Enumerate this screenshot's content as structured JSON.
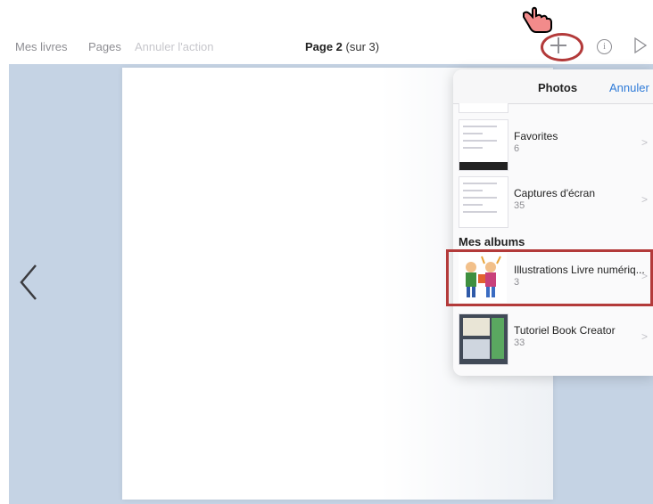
{
  "toolbar": {
    "my_books": "Mes livres",
    "pages": "Pages",
    "undo": "Annuler l'action",
    "page_label": "Page 2",
    "page_total": "(sur 3)"
  },
  "icons": {
    "add": "plus-icon",
    "info": "info-icon",
    "play": "play-icon",
    "back": "chevron-left-icon",
    "cursor": "hand-pointer-icon"
  },
  "colors": {
    "accent": "#2f7bd8",
    "highlight": "#b33a3a",
    "workspace": "#c5d3e4"
  },
  "popover": {
    "title": "Photos",
    "cancel": "Annuler",
    "albums": [
      {
        "label": "Favorites",
        "count": "6"
      },
      {
        "label": "Captures d'écran",
        "count": "35"
      }
    ],
    "my_albums_title": "Mes albums",
    "my_albums": [
      {
        "label": "Illustrations Livre numériq...",
        "count": "3"
      },
      {
        "label": "Tutoriel Book Creator",
        "count": "33"
      }
    ]
  }
}
